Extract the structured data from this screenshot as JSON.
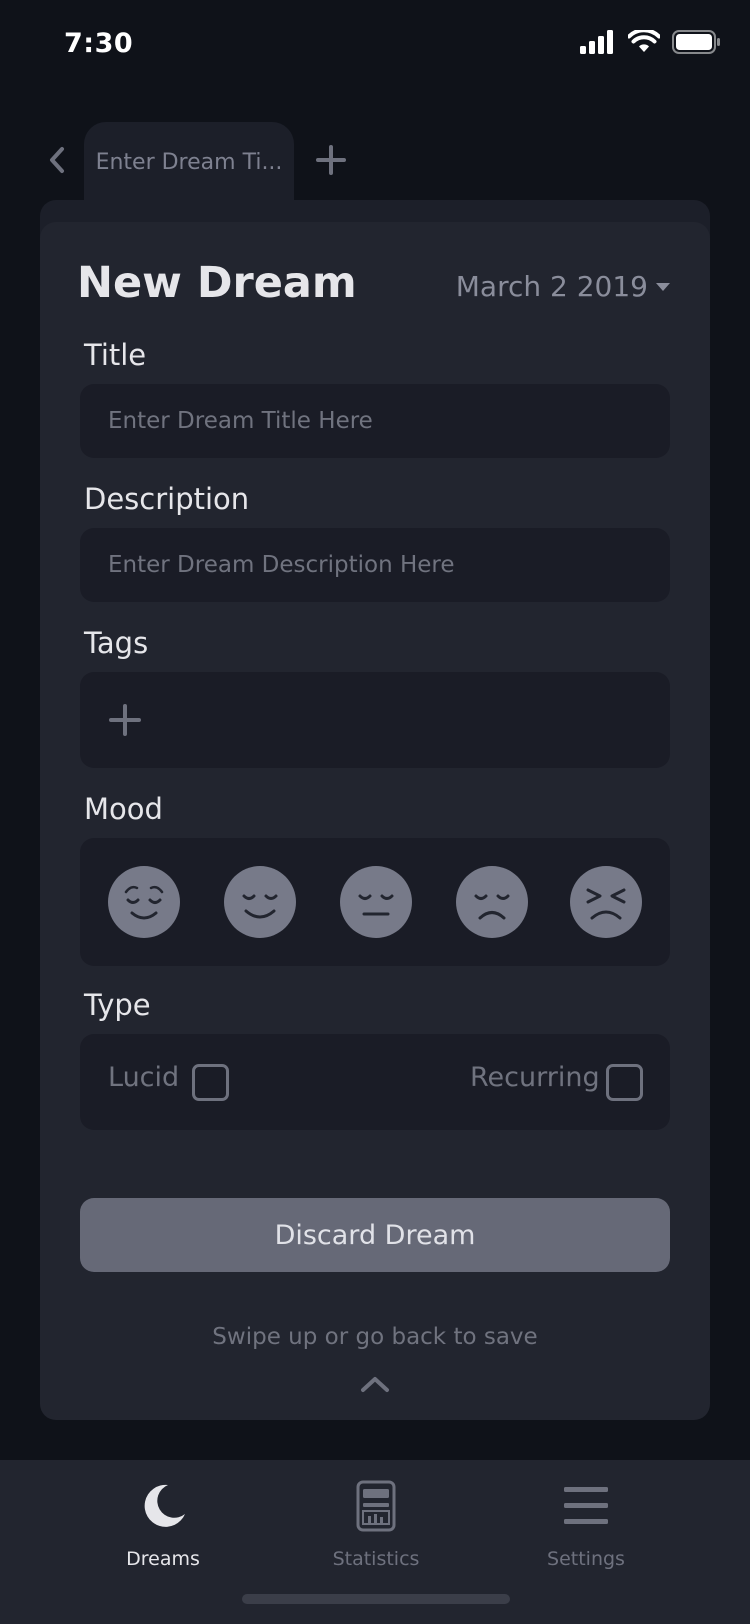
{
  "status_bar": {
    "time": "7:30"
  },
  "tabs": {
    "active_label": "Enter Dream Ti...",
    "back_icon": "chevron-left-icon",
    "add_icon": "plus-icon"
  },
  "form": {
    "title": "New Dream",
    "date": "March 2 2019",
    "title_label": "Title",
    "title_placeholder": "Enter Dream Title Here",
    "description_label": "Description",
    "description_placeholder": "Enter Dream Description Here",
    "tags_label": "Tags",
    "mood_label": "Mood",
    "moods": [
      "relieved",
      "smiling",
      "neutral",
      "sad",
      "distressed"
    ],
    "type_label": "Type",
    "type_options": [
      {
        "label": "Lucid",
        "checked": false
      },
      {
        "label": "Recurring",
        "checked": false
      }
    ],
    "discard_label": "Discard Dream",
    "swipe_hint": "Swipe up or go back to save"
  },
  "nav": {
    "items": [
      {
        "label": "Dreams",
        "icon": "moon-icon",
        "active": true
      },
      {
        "label": "Statistics",
        "icon": "calculator-icon",
        "active": false
      },
      {
        "label": "Settings",
        "icon": "menu-icon",
        "active": false
      }
    ]
  },
  "colors": {
    "background": "#0f1219",
    "card": "#22252f",
    "field": "#1a1c26",
    "button": "#666977",
    "accent_text": "#e6e6ea"
  }
}
